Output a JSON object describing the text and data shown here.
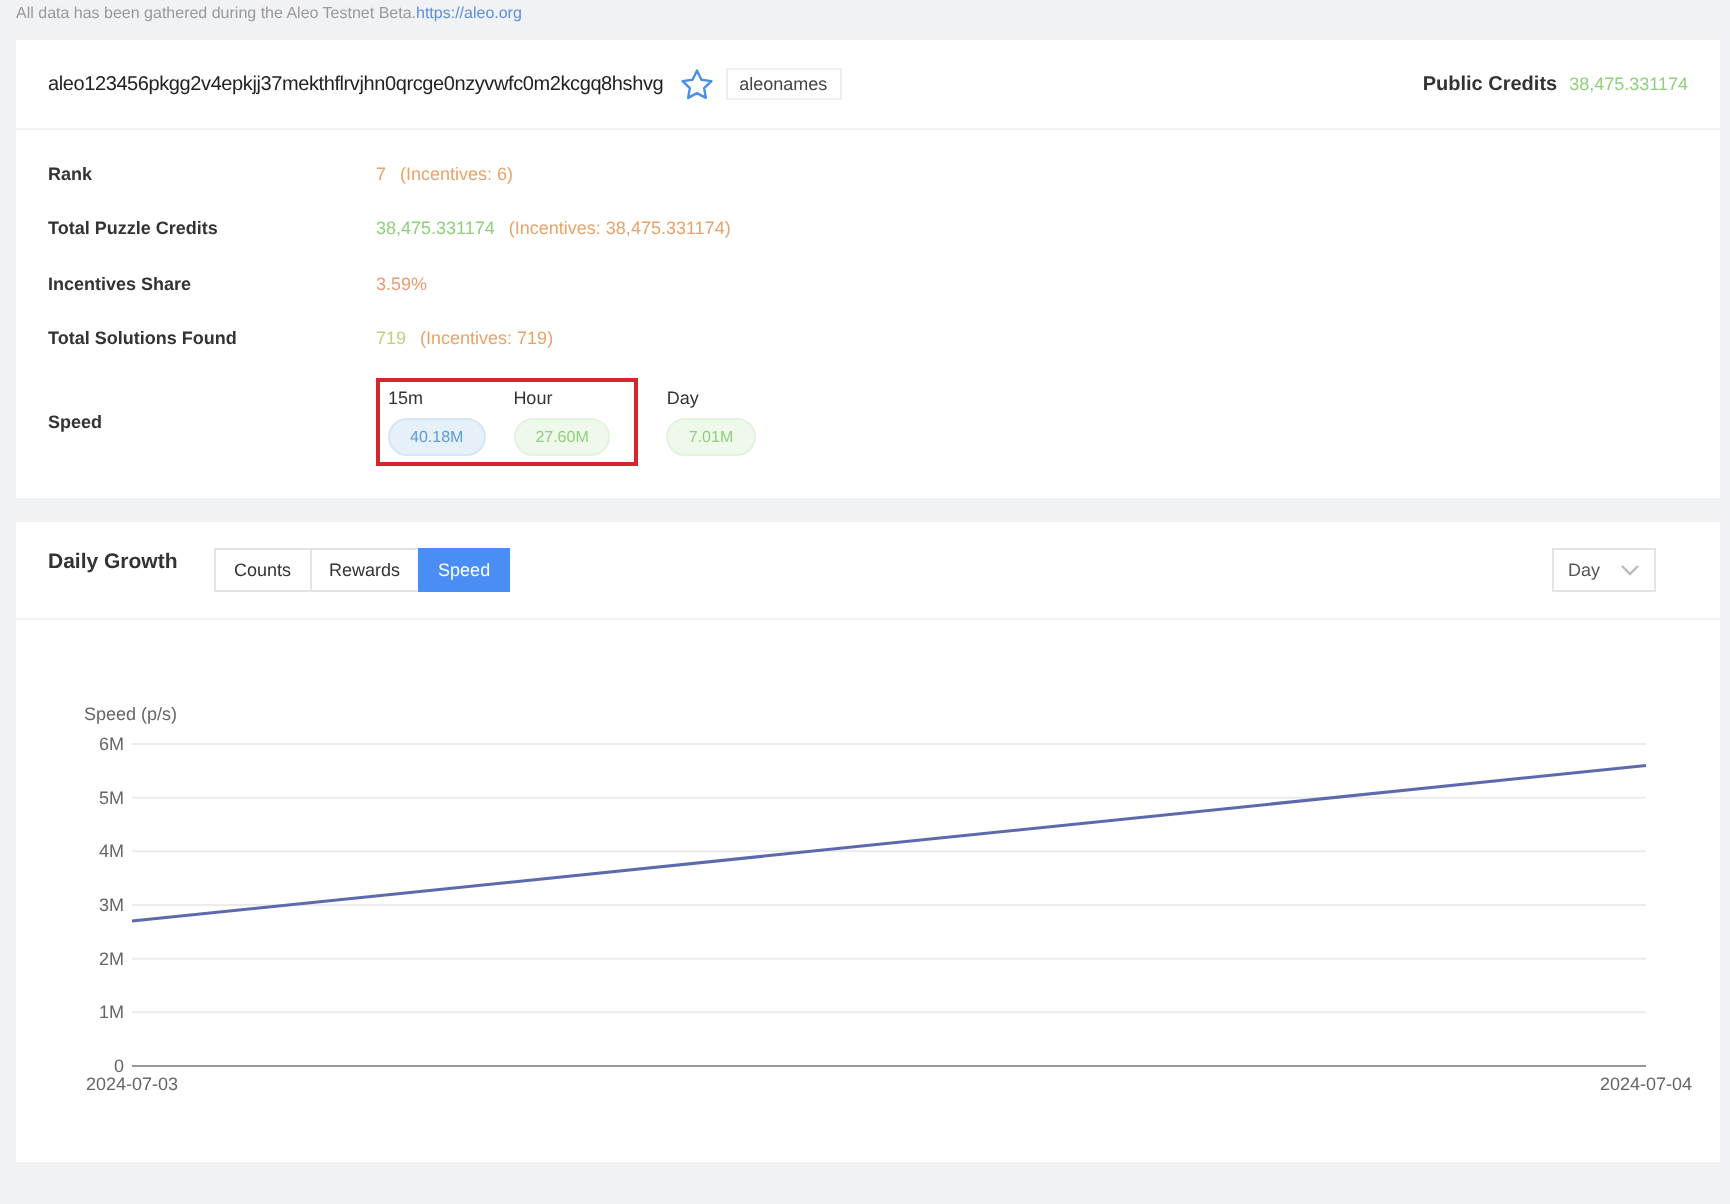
{
  "notice": {
    "text": "All data has been gathered during the Aleo Testnet Beta.",
    "link": "https://aleo.org"
  },
  "account": {
    "address": "aleo123456pkgg2v4epkjj37mekthflrvjhn0qrcge0nzyvwfc0m2kcgq8hshvg",
    "starred": false,
    "tag": "aleonames",
    "credits_label": "Public Credits",
    "credits_value": "38,475.331174"
  },
  "details": [
    {
      "label": "Rank",
      "value": "7",
      "color": "#e9a368",
      "incentives": "(Incentives: 6)"
    },
    {
      "label": "Total Puzzle Credits",
      "value": "38,475.331174",
      "color": "#8fd07a",
      "incentives": "(Incentives: 38,475.331174)"
    },
    {
      "label": "Incentives Share",
      "value": "3.59%",
      "color": "#ec9a72"
    },
    {
      "label": "Total Solutions Found",
      "value": "719",
      "color": "#bfd27a",
      "incentives": "(Incentives: 719)"
    }
  ],
  "speed": {
    "label": "Speed",
    "items": [
      {
        "label": "15m",
        "value": "40.18M",
        "color": "#5b9bd8",
        "highlighted": true
      },
      {
        "label": "Hour",
        "value": "27.60M",
        "color": "#8fd07a",
        "highlighted": true
      },
      {
        "label": "Day",
        "value": "7.01M",
        "color": "#8fd07a",
        "highlighted": false
      }
    ]
  },
  "growth": {
    "title": "Daily Growth",
    "tabs": [
      {
        "label": "Counts",
        "selected": false
      },
      {
        "label": "Rewards",
        "selected": false
      },
      {
        "label": "Speed",
        "selected": true
      }
    ],
    "period": "Day",
    "chart_data": {
      "type": "line",
      "ylabel": "Speed (p/s)",
      "categories": [
        "2024-07-03",
        "2024-07-04"
      ],
      "series": [
        {
          "color": "#5c6aad",
          "values": [
            2700000,
            5600000
          ]
        }
      ],
      "ylim": [
        0,
        6000000
      ],
      "yticks": [
        {
          "value": 0,
          "label": "0"
        },
        {
          "value": 1000000,
          "label": "1M"
        },
        {
          "value": 2000000,
          "label": "2M"
        },
        {
          "value": 3000000,
          "label": "3M"
        },
        {
          "value": 4000000,
          "label": "4M"
        },
        {
          "value": 5000000,
          "label": "5M"
        },
        {
          "value": 6000000,
          "label": "6M"
        }
      ]
    }
  }
}
